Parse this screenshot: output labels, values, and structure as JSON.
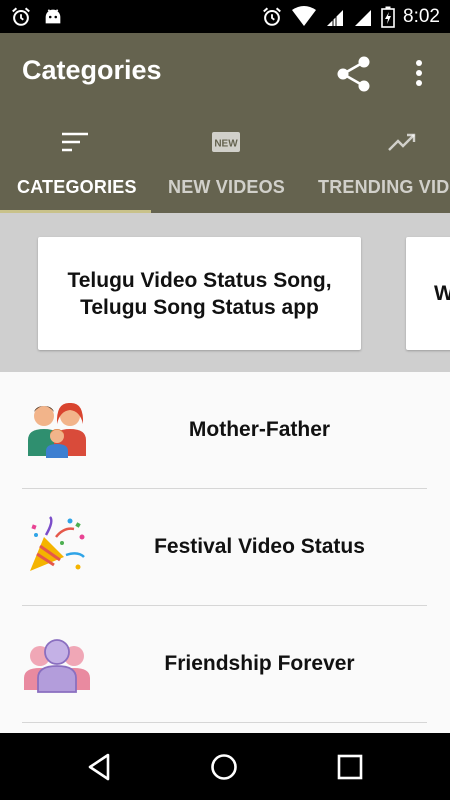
{
  "status_bar": {
    "time": "8:02",
    "left_icons": [
      "alarm-icon",
      "android-icon"
    ],
    "right_icons": [
      "alarm-icon",
      "wifi-icon",
      "signal-icon",
      "signal-icon",
      "battery-charging-icon"
    ]
  },
  "toolbar": {
    "title": "Categories",
    "background": "#65634f",
    "actions": [
      "share-icon",
      "overflow-menu-icon"
    ]
  },
  "tabs": [
    {
      "label": "CATEGORIES",
      "icon": "sort-icon",
      "active": true
    },
    {
      "label": "NEW VIDEOS",
      "icon": "new-badge-icon",
      "active": false
    },
    {
      "label": "TRENDING VID",
      "icon": "trending-up-icon",
      "active": false
    }
  ],
  "tab_indicator_color": "#c9c28a",
  "carousel": {
    "cards": [
      {
        "text": "Telugu Video Status Song,\nTelugu Song Status app"
      },
      {
        "text": "W"
      }
    ]
  },
  "categories": [
    {
      "label": "Mother-Father",
      "icon": "family-icon"
    },
    {
      "label": "Festival Video Status",
      "icon": "party-popper-icon"
    },
    {
      "label": "Friendship Forever",
      "icon": "friends-icon"
    }
  ],
  "nav_bar": {
    "buttons": [
      "back-icon",
      "home-icon",
      "recents-icon"
    ]
  }
}
